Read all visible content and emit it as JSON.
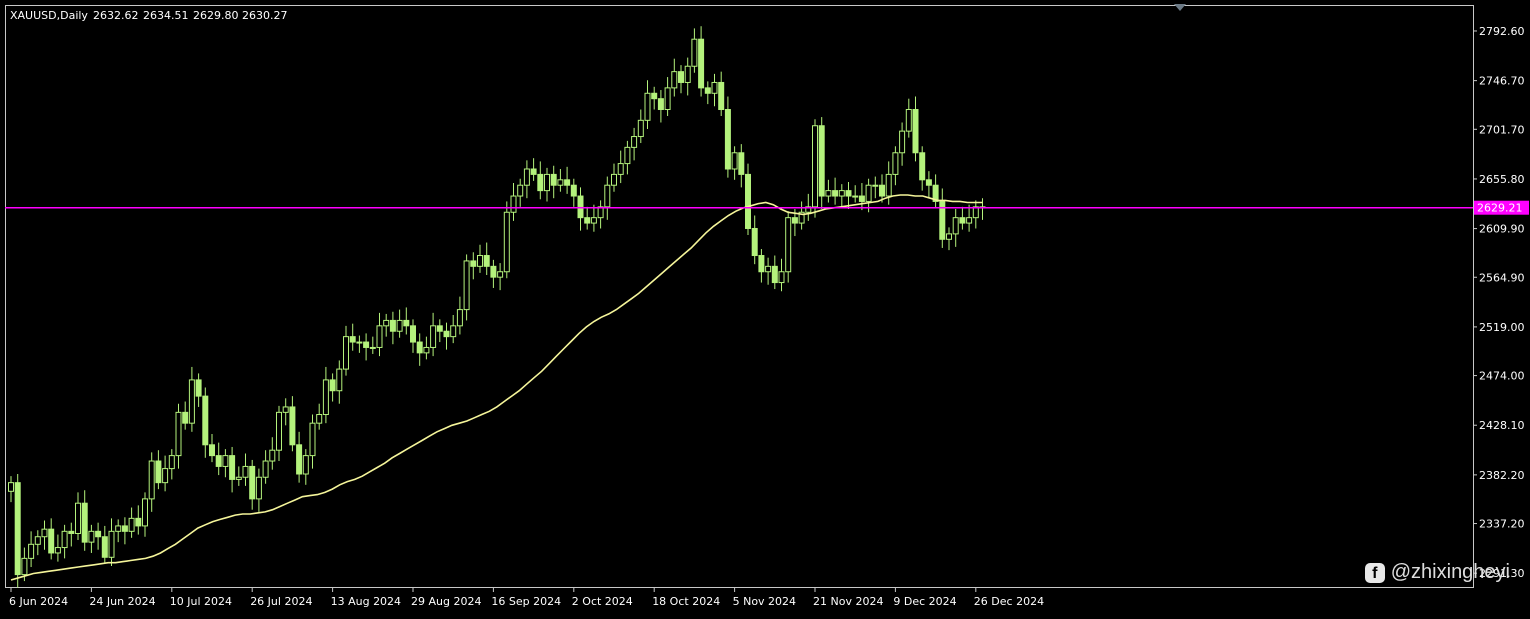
{
  "header": {
    "symbol": "XAUUSD,Daily",
    "open": "2632.62",
    "high": "2634.51",
    "low": "2629.80",
    "close": "2630.27"
  },
  "watermark": {
    "icon": "brand-logo-icon",
    "text": "@zhixingheyi"
  },
  "colors": {
    "background": "#000000",
    "frame": "#c8c8c8",
    "candle": "#b4f27c",
    "moving_average": "#f5f59a",
    "price_line": "#ff00ff",
    "axis_text": "#ffffff"
  },
  "chart_data": {
    "type": "candlestick",
    "title": "XAUUSD,Daily",
    "grid": false,
    "y_ticks": [
      "2792.60",
      "2746.70",
      "2701.70",
      "2655.80",
      "2609.90",
      "2564.90",
      "2519.00",
      "2474.00",
      "2428.10",
      "2382.20",
      "2337.20",
      "2291.30"
    ],
    "ylim": [
      2285.0,
      2812.0
    ],
    "x_ticks": [
      {
        "label": "6 Jun 2024",
        "index": 0
      },
      {
        "label": "24 Jun 2024",
        "index": 12
      },
      {
        "label": "10 Jul 2024",
        "index": 24
      },
      {
        "label": "26 Jul 2024",
        "index": 36
      },
      {
        "label": "13 Aug 2024",
        "index": 48
      },
      {
        "label": "29 Aug 2024",
        "index": 60
      },
      {
        "label": "16 Sep 2024",
        "index": 72
      },
      {
        "label": "2 Oct 2024",
        "index": 84
      },
      {
        "label": "18 Oct 2024",
        "index": 96
      },
      {
        "label": "5 Nov 2024",
        "index": 108
      },
      {
        "label": "21 Nov 2024",
        "index": 120
      },
      {
        "label": "9 Dec 2024",
        "index": 132
      },
      {
        "label": "26 Dec 2024",
        "index": 144
      }
    ],
    "current_price": {
      "value": 2629.21,
      "label": "2629.21"
    },
    "series_ohlc_close": [
      2375,
      2290,
      2305,
      2318,
      2325,
      2332,
      2310,
      2315,
      2330,
      2328,
      2356,
      2320,
      2330,
      2325,
      2306,
      2330,
      2335,
      2330,
      2342,
      2335,
      2360,
      2395,
      2375,
      2388,
      2400,
      2440,
      2430,
      2470,
      2455,
      2410,
      2400,
      2390,
      2400,
      2378,
      2380,
      2390,
      2360,
      2380,
      2395,
      2405,
      2440,
      2445,
      2410,
      2383,
      2400,
      2430,
      2438,
      2470,
      2460,
      2480,
      2510,
      2505,
      2505,
      2500,
      2500,
      2520,
      2525,
      2515,
      2525,
      2520,
      2505,
      2495,
      2500,
      2520,
      2515,
      2510,
      2520,
      2535,
      2580,
      2575,
      2585,
      2575,
      2565,
      2570,
      2625,
      2640,
      2650,
      2665,
      2660,
      2645,
      2660,
      2650,
      2655,
      2650,
      2640,
      2620,
      2615,
      2620,
      2630,
      2650,
      2660,
      2670,
      2685,
      2695,
      2710,
      2735,
      2730,
      2720,
      2740,
      2755,
      2745,
      2760,
      2785,
      2740,
      2735,
      2745,
      2720,
      2665,
      2680,
      2660,
      2610,
      2585,
      2570,
      2575,
      2560,
      2570,
      2620,
      2615,
      2625,
      2630,
      2705,
      2640,
      2645,
      2640,
      2645,
      2640,
      2640,
      2635,
      2650,
      2650,
      2640,
      2660,
      2680,
      2700,
      2720,
      2680,
      2655,
      2650,
      2635,
      2600,
      2605,
      2620,
      2615,
      2620,
      2630,
      2630
    ],
    "moving_average": [
      2285,
      2287,
      2289,
      2291,
      2292,
      2293,
      2294,
      2295,
      2296,
      2297,
      2298,
      2299,
      2300,
      2301,
      2301,
      2302,
      2303,
      2304,
      2305,
      2307,
      2310,
      2314,
      2318,
      2323,
      2328,
      2333,
      2336,
      2339,
      2341,
      2343,
      2345,
      2346,
      2346,
      2347,
      2348,
      2350,
      2353,
      2356,
      2359,
      2362,
      2363,
      2364,
      2366,
      2369,
      2373,
      2376,
      2378,
      2381,
      2385,
      2389,
      2393,
      2398,
      2402,
      2406,
      2410,
      2414,
      2418,
      2422,
      2425,
      2428,
      2430,
      2432,
      2435,
      2438,
      2441,
      2445,
      2450,
      2455,
      2460,
      2466,
      2472,
      2478,
      2485,
      2492,
      2499,
      2506,
      2513,
      2519,
      2524,
      2528,
      2531,
      2535,
      2540,
      2545,
      2550,
      2556,
      2562,
      2568,
      2574,
      2580,
      2586,
      2592,
      2599,
      2606,
      2612,
      2617,
      2622,
      2626,
      2629,
      2631,
      2633,
      2634,
      2632,
      2628,
      2625,
      2624,
      2623,
      2624,
      2626,
      2628,
      2629,
      2630,
      2631,
      2632,
      2633,
      2634,
      2635,
      2638,
      2640,
      2641,
      2641,
      2640,
      2640,
      2638,
      2636,
      2636,
      2635,
      2635,
      2634,
      2634,
      2634
    ]
  }
}
